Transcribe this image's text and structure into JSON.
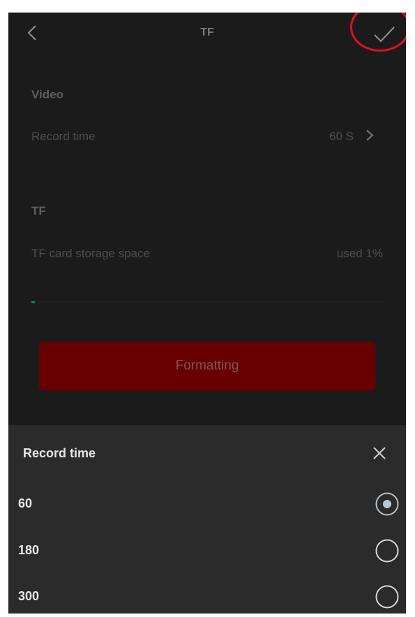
{
  "header": {
    "title": "TF",
    "back_icon": "chevron-left-icon",
    "confirm_icon": "check-icon"
  },
  "video_section": {
    "title": "Video",
    "record_time_label": "Record time",
    "record_time_value": "60 S"
  },
  "tf_section": {
    "title": "TF",
    "storage_label": "TF card storage space",
    "storage_value": "used 1%",
    "storage_used_fraction": 0.01
  },
  "format_button": {
    "label": "Formatting"
  },
  "sheet": {
    "title": "Record time",
    "close_icon": "close-icon",
    "options": [
      {
        "label": "60",
        "selected": true
      },
      {
        "label": "180",
        "selected": false
      },
      {
        "label": "300",
        "selected": false
      }
    ]
  },
  "colors": {
    "highlight": "#e0101a",
    "progress": "#1a7f5e",
    "button": "#690000"
  }
}
